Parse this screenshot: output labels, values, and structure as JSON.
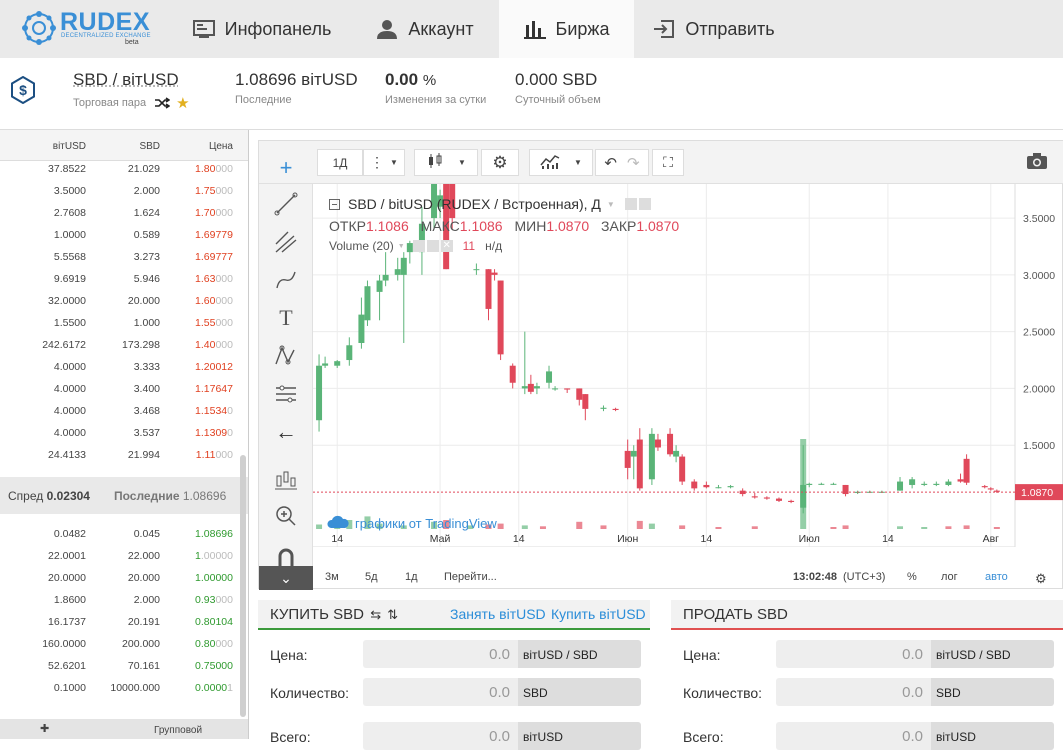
{
  "nav": {
    "logo": {
      "brand": "RUDEX",
      "tagline": "DECENTRALIZED EXCHANGE",
      "beta": "beta"
    },
    "tabs": [
      {
        "label": "Инфопанель",
        "icon": "dashboard-icon"
      },
      {
        "label": "Аккаунт",
        "icon": "user-icon"
      },
      {
        "label": "Биржа",
        "icon": "chart-bars-icon",
        "active": true
      },
      {
        "label": "Отправить",
        "icon": "send-icon"
      }
    ]
  },
  "pair": {
    "name": "SBD / вітUSD",
    "name_label": "Торговая пара",
    "last_value": "1.08696 вітUSD",
    "last_label": "Последние",
    "change_value": "0.00",
    "change_unit": "%",
    "change_label": "Изменения за сутки",
    "volume_value": "0.000 SBD",
    "volume_label": "Суточный объем"
  },
  "orderbook": {
    "headers": [
      "вітUSD",
      "SBD",
      "Цена"
    ],
    "asks": [
      {
        "total": "37.8522",
        "amount": "21.029",
        "price": "1.80",
        "dim": "000"
      },
      {
        "total": "3.5000",
        "amount": "2.000",
        "price": "1.75",
        "dim": "000"
      },
      {
        "total": "2.7608",
        "amount": "1.624",
        "price": "1.70",
        "dim": "000"
      },
      {
        "total": "1.0000",
        "amount": "0.589",
        "price": "1.69779",
        "dim": ""
      },
      {
        "total": "5.5568",
        "amount": "3.273",
        "price": "1.69777",
        "dim": ""
      },
      {
        "total": "9.6919",
        "amount": "5.946",
        "price": "1.63",
        "dim": "000"
      },
      {
        "total": "32.0000",
        "amount": "20.000",
        "price": "1.60",
        "dim": "000"
      },
      {
        "total": "1.5500",
        "amount": "1.000",
        "price": "1.55",
        "dim": "000"
      },
      {
        "total": "242.6172",
        "amount": "173.298",
        "price": "1.40",
        "dim": "000"
      },
      {
        "total": "4.0000",
        "amount": "3.333",
        "price": "1.20012",
        "dim": ""
      },
      {
        "total": "4.0000",
        "amount": "3.400",
        "price": "1.17647",
        "dim": ""
      },
      {
        "total": "4.0000",
        "amount": "3.468",
        "price": "1.1534",
        "dim": "0"
      },
      {
        "total": "4.0000",
        "amount": "3.537",
        "price": "1.1309",
        "dim": "0"
      },
      {
        "total": "24.4133",
        "amount": "21.994",
        "price": "1.11",
        "dim": "000"
      }
    ],
    "spread_label": "Спред",
    "spread_value": "0.02304",
    "last_label": "Последние",
    "last_value": "1.08696",
    "bids": [
      {
        "total": "0.0482",
        "amount": "0.045",
        "price": "1.08696",
        "dim": ""
      },
      {
        "total": "22.0001",
        "amount": "22.000",
        "price": "1",
        "dim": ".00000"
      },
      {
        "total": "20.0000",
        "amount": "20.000",
        "price": "1.00000",
        "dim": ""
      },
      {
        "total": "1.8600",
        "amount": "2.000",
        "price": "0.93",
        "dim": "000"
      },
      {
        "total": "16.1737",
        "amount": "20.191",
        "price": "0.80104",
        "dim": ""
      },
      {
        "total": "160.0000",
        "amount": "200.000",
        "price": "0.80",
        "dim": "000"
      },
      {
        "total": "52.6201",
        "amount": "70.161",
        "price": "0.75000",
        "dim": ""
      },
      {
        "total": "0.1000",
        "amount": "10000.000",
        "price": "0.0000",
        "dim": "1"
      }
    ],
    "footer_label": "Групповой"
  },
  "chart_toolbar": {
    "interval": "1Д"
  },
  "chart_data": {
    "type": "candlestick",
    "title": "SBD / bitUSD (RUDEX / Встроенная), Д",
    "ohlc_labels": {
      "open": "ОТКР",
      "high": "МАКС",
      "low": "МИН",
      "close": "ЗАКР"
    },
    "ohlc_values": {
      "open": "1.1086",
      "high": "1.1086",
      "low": "1.0870",
      "close": "1.0870"
    },
    "volume_label": "Volume (20)",
    "volume_value": "11",
    "volume_na": "н/д",
    "last_price_label": "1.0870",
    "ylim": [
      1.0,
      3.8
    ],
    "yticks": [
      "3.5000",
      "3.0000",
      "2.5000",
      "2.0000",
      "1.5000"
    ],
    "ytick_values": [
      3.5,
      3.0,
      2.5,
      2.0,
      1.5
    ],
    "xticks": [
      "14",
      "Май",
      "14",
      "Июн",
      "14",
      "Июл",
      "14",
      "Авг"
    ],
    "xtick_days": [
      3,
      20,
      33,
      51,
      64,
      81,
      94,
      111
    ],
    "watermark": "графики от TradingView",
    "candles": [
      {
        "d": 0,
        "o": 1.72,
        "h": 2.3,
        "l": 1.62,
        "c": 2.2
      },
      {
        "d": 1,
        "o": 2.2,
        "h": 2.28,
        "l": 2.18,
        "c": 2.22
      },
      {
        "d": 3,
        "o": 2.2,
        "h": 2.25,
        "l": 2.18,
        "c": 2.24
      },
      {
        "d": 5,
        "o": 2.25,
        "h": 2.45,
        "l": 2.2,
        "c": 2.38
      },
      {
        "d": 7,
        "o": 2.4,
        "h": 2.8,
        "l": 2.35,
        "c": 2.65
      },
      {
        "d": 8,
        "o": 2.6,
        "h": 2.95,
        "l": 2.55,
        "c": 2.9
      },
      {
        "d": 10,
        "o": 2.85,
        "h": 3.0,
        "l": 2.6,
        "c": 2.95
      },
      {
        "d": 11,
        "o": 2.95,
        "h": 3.2,
        "l": 2.9,
        "c": 3.0
      },
      {
        "d": 13,
        "o": 3.0,
        "h": 3.15,
        "l": 2.95,
        "c": 3.05
      },
      {
        "d": 14,
        "o": 3.0,
        "h": 3.2,
        "l": 2.4,
        "c": 3.15
      },
      {
        "d": 15,
        "o": 3.2,
        "h": 3.3,
        "l": 3.1,
        "c": 3.28
      },
      {
        "d": 17,
        "o": 3.2,
        "h": 3.6,
        "l": 3.0,
        "c": 3.45
      },
      {
        "d": 19,
        "o": 3.5,
        "h": 3.9,
        "l": 3.4,
        "c": 3.85
      },
      {
        "d": 20,
        "o": 3.6,
        "h": 3.75,
        "l": 3.5,
        "c": 3.7
      },
      {
        "d": 21,
        "o": 3.9,
        "h": 3.9,
        "l": 3.05,
        "c": 3.05
      },
      {
        "d": 22,
        "o": 3.85,
        "h": 3.95,
        "l": 3.4,
        "c": 3.5
      },
      {
        "d": 26,
        "o": 3.05,
        "h": 3.1,
        "l": 3.0,
        "c": 3.05
      },
      {
        "d": 28,
        "o": 3.05,
        "h": 3.05,
        "l": 2.6,
        "c": 2.7
      },
      {
        "d": 29,
        "o": 3.02,
        "h": 3.05,
        "l": 2.95,
        "c": 3.0
      },
      {
        "d": 30,
        "o": 2.95,
        "h": 2.95,
        "l": 2.25,
        "c": 2.3
      },
      {
        "d": 32,
        "o": 2.2,
        "h": 2.22,
        "l": 2.0,
        "c": 2.05
      },
      {
        "d": 34,
        "o": 2.0,
        "h": 2.5,
        "l": 1.95,
        "c": 2.02
      },
      {
        "d": 35,
        "o": 2.04,
        "h": 2.12,
        "l": 1.95,
        "c": 1.97
      },
      {
        "d": 36,
        "o": 2.0,
        "h": 2.05,
        "l": 1.95,
        "c": 2.02
      },
      {
        "d": 38,
        "o": 2.05,
        "h": 2.2,
        "l": 2.0,
        "c": 2.15
      },
      {
        "d": 39,
        "o": 2.0,
        "h": 2.02,
        "l": 1.98,
        "c": 2.0
      },
      {
        "d": 41,
        "o": 2.0,
        "h": 2.0,
        "l": 1.96,
        "c": 1.99
      },
      {
        "d": 43,
        "o": 2.0,
        "h": 2.0,
        "l": 1.85,
        "c": 1.9
      },
      {
        "d": 44,
        "o": 1.95,
        "h": 1.95,
        "l": 1.72,
        "c": 1.82
      },
      {
        "d": 47,
        "o": 1.82,
        "h": 1.85,
        "l": 1.8,
        "c": 1.83
      },
      {
        "d": 49,
        "o": 1.82,
        "h": 1.83,
        "l": 1.8,
        "c": 1.81
      },
      {
        "d": 51,
        "o": 1.45,
        "h": 1.55,
        "l": 1.2,
        "c": 1.3
      },
      {
        "d": 52,
        "o": 1.4,
        "h": 1.5,
        "l": 1.2,
        "c": 1.45
      },
      {
        "d": 53,
        "o": 1.55,
        "h": 1.65,
        "l": 1.1,
        "c": 1.12
      },
      {
        "d": 55,
        "o": 1.2,
        "h": 1.65,
        "l": 1.15,
        "c": 1.6
      },
      {
        "d": 56,
        "o": 1.55,
        "h": 1.6,
        "l": 1.45,
        "c": 1.48
      },
      {
        "d": 58,
        "o": 1.6,
        "h": 1.65,
        "l": 1.4,
        "c": 1.42
      },
      {
        "d": 59,
        "o": 1.4,
        "h": 1.5,
        "l": 1.35,
        "c": 1.45
      },
      {
        "d": 60,
        "o": 1.4,
        "h": 1.42,
        "l": 1.15,
        "c": 1.18
      },
      {
        "d": 62,
        "o": 1.18,
        "h": 1.2,
        "l": 1.1,
        "c": 1.12
      },
      {
        "d": 64,
        "o": 1.15,
        "h": 1.18,
        "l": 1.12,
        "c": 1.13
      },
      {
        "d": 66,
        "o": 1.13,
        "h": 1.15,
        "l": 1.12,
        "c": 1.13
      },
      {
        "d": 68,
        "o": 1.13,
        "h": 1.15,
        "l": 1.12,
        "c": 1.14
      },
      {
        "d": 70,
        "o": 1.1,
        "h": 1.12,
        "l": 1.05,
        "c": 1.07
      },
      {
        "d": 72,
        "o": 1.05,
        "h": 1.08,
        "l": 1.03,
        "c": 1.04
      },
      {
        "d": 74,
        "o": 1.04,
        "h": 1.05,
        "l": 1.02,
        "c": 1.03
      },
      {
        "d": 76,
        "o": 1.03,
        "h": 1.04,
        "l": 1.0,
        "c": 1.01
      },
      {
        "d": 78,
        "o": 1.01,
        "h": 1.02,
        "l": 0.99,
        "c": 1.0
      },
      {
        "d": 80,
        "o": 0.95,
        "h": 1.5,
        "l": 0.9,
        "c": 1.15
      },
      {
        "d": 81,
        "o": 1.15,
        "h": 1.17,
        "l": 1.13,
        "c": 1.16
      },
      {
        "d": 83,
        "o": 1.16,
        "h": 1.17,
        "l": 1.15,
        "c": 1.16
      },
      {
        "d": 85,
        "o": 1.16,
        "h": 1.17,
        "l": 1.15,
        "c": 1.16
      },
      {
        "d": 87,
        "o": 1.15,
        "h": 1.15,
        "l": 1.05,
        "c": 1.07
      },
      {
        "d": 89,
        "o": 1.08,
        "h": 1.1,
        "l": 1.07,
        "c": 1.09
      },
      {
        "d": 91,
        "o": 1.09,
        "h": 1.1,
        "l": 1.08,
        "c": 1.09
      },
      {
        "d": 93,
        "o": 1.09,
        "h": 1.1,
        "l": 1.08,
        "c": 1.09
      },
      {
        "d": 96,
        "o": 1.1,
        "h": 1.22,
        "l": 1.1,
        "c": 1.18
      },
      {
        "d": 98,
        "o": 1.15,
        "h": 1.22,
        "l": 1.12,
        "c": 1.2
      },
      {
        "d": 100,
        "o": 1.15,
        "h": 1.18,
        "l": 1.14,
        "c": 1.16
      },
      {
        "d": 102,
        "o": 1.15,
        "h": 1.18,
        "l": 1.14,
        "c": 1.16
      },
      {
        "d": 104,
        "o": 1.15,
        "h": 1.2,
        "l": 1.14,
        "c": 1.18
      },
      {
        "d": 106,
        "o": 1.2,
        "h": 1.25,
        "l": 1.17,
        "c": 1.18
      },
      {
        "d": 107,
        "o": 1.38,
        "h": 1.42,
        "l": 1.15,
        "c": 1.17
      },
      {
        "d": 110,
        "o": 1.14,
        "h": 1.15,
        "l": 1.12,
        "c": 1.13
      },
      {
        "d": 111,
        "o": 1.12,
        "h": 1.13,
        "l": 1.1,
        "c": 1.11
      },
      {
        "d": 112,
        "o": 1.1,
        "h": 1.11,
        "l": 1.08,
        "c": 1.09
      }
    ],
    "volumes": [
      {
        "d": 0,
        "v": 5,
        "up": true
      },
      {
        "d": 3,
        "v": 3,
        "up": true
      },
      {
        "d": 5,
        "v": 10,
        "up": true
      },
      {
        "d": 8,
        "v": 14,
        "up": true
      },
      {
        "d": 10,
        "v": 6,
        "up": true
      },
      {
        "d": 14,
        "v": 4,
        "up": true
      },
      {
        "d": 19,
        "v": 8,
        "up": true
      },
      {
        "d": 21,
        "v": 10,
        "up": false
      },
      {
        "d": 25,
        "v": 4,
        "up": true
      },
      {
        "d": 28,
        "v": 5,
        "up": false
      },
      {
        "d": 30,
        "v": 6,
        "up": false
      },
      {
        "d": 34,
        "v": 4,
        "up": true
      },
      {
        "d": 37,
        "v": 3,
        "up": false
      },
      {
        "d": 43,
        "v": 8,
        "up": false
      },
      {
        "d": 47,
        "v": 4,
        "up": false
      },
      {
        "d": 53,
        "v": 9,
        "up": false
      },
      {
        "d": 55,
        "v": 6,
        "up": true
      },
      {
        "d": 60,
        "v": 4,
        "up": false
      },
      {
        "d": 66,
        "v": 2,
        "up": false
      },
      {
        "d": 72,
        "v": 3,
        "up": false
      },
      {
        "d": 80,
        "v": 100,
        "up": true
      },
      {
        "d": 85,
        "v": 2,
        "up": false
      },
      {
        "d": 87,
        "v": 4,
        "up": false
      },
      {
        "d": 96,
        "v": 3,
        "up": true
      },
      {
        "d": 100,
        "v": 2,
        "up": true
      },
      {
        "d": 104,
        "v": 3,
        "up": false
      },
      {
        "d": 107,
        "v": 4,
        "up": false
      },
      {
        "d": 112,
        "v": 2,
        "up": false
      }
    ],
    "colors": {
      "up": "#5ab478",
      "down": "#e0485a",
      "grid": "#ececec",
      "last": "#e0485a"
    }
  },
  "chart_footer": {
    "ranges": [
      "3м",
      "5д",
      "1д"
    ],
    "goto": "Перейти...",
    "time": "13:02:48",
    "tz": "(UTC+3)",
    "percent": "%",
    "log": "лог",
    "auto": "авто"
  },
  "buy": {
    "title": "КУПИТЬ SBD",
    "borrow_link": "Занять вітUSD",
    "buy_link": "Купить вітUSD",
    "price_label": "Цена:",
    "price_value": "0.0",
    "price_unit": "вітUSD / SBD",
    "amount_label": "Количество:",
    "amount_value": "0.0",
    "amount_unit": "SBD",
    "total_label": "Всего:",
    "total_value": "0.0",
    "total_unit": "вітUSD",
    "accent": "#3c9a3c"
  },
  "sell": {
    "title": "ПРОДАТЬ SBD",
    "price_label": "Цена:",
    "price_value": "0.0",
    "price_unit": "вітUSD / SBD",
    "amount_label": "Количество:",
    "amount_value": "0.0",
    "amount_unit": "SBD",
    "total_label": "Всего:",
    "total_value": "0.0",
    "total_unit": "вітUSD",
    "accent": "#e05050"
  }
}
